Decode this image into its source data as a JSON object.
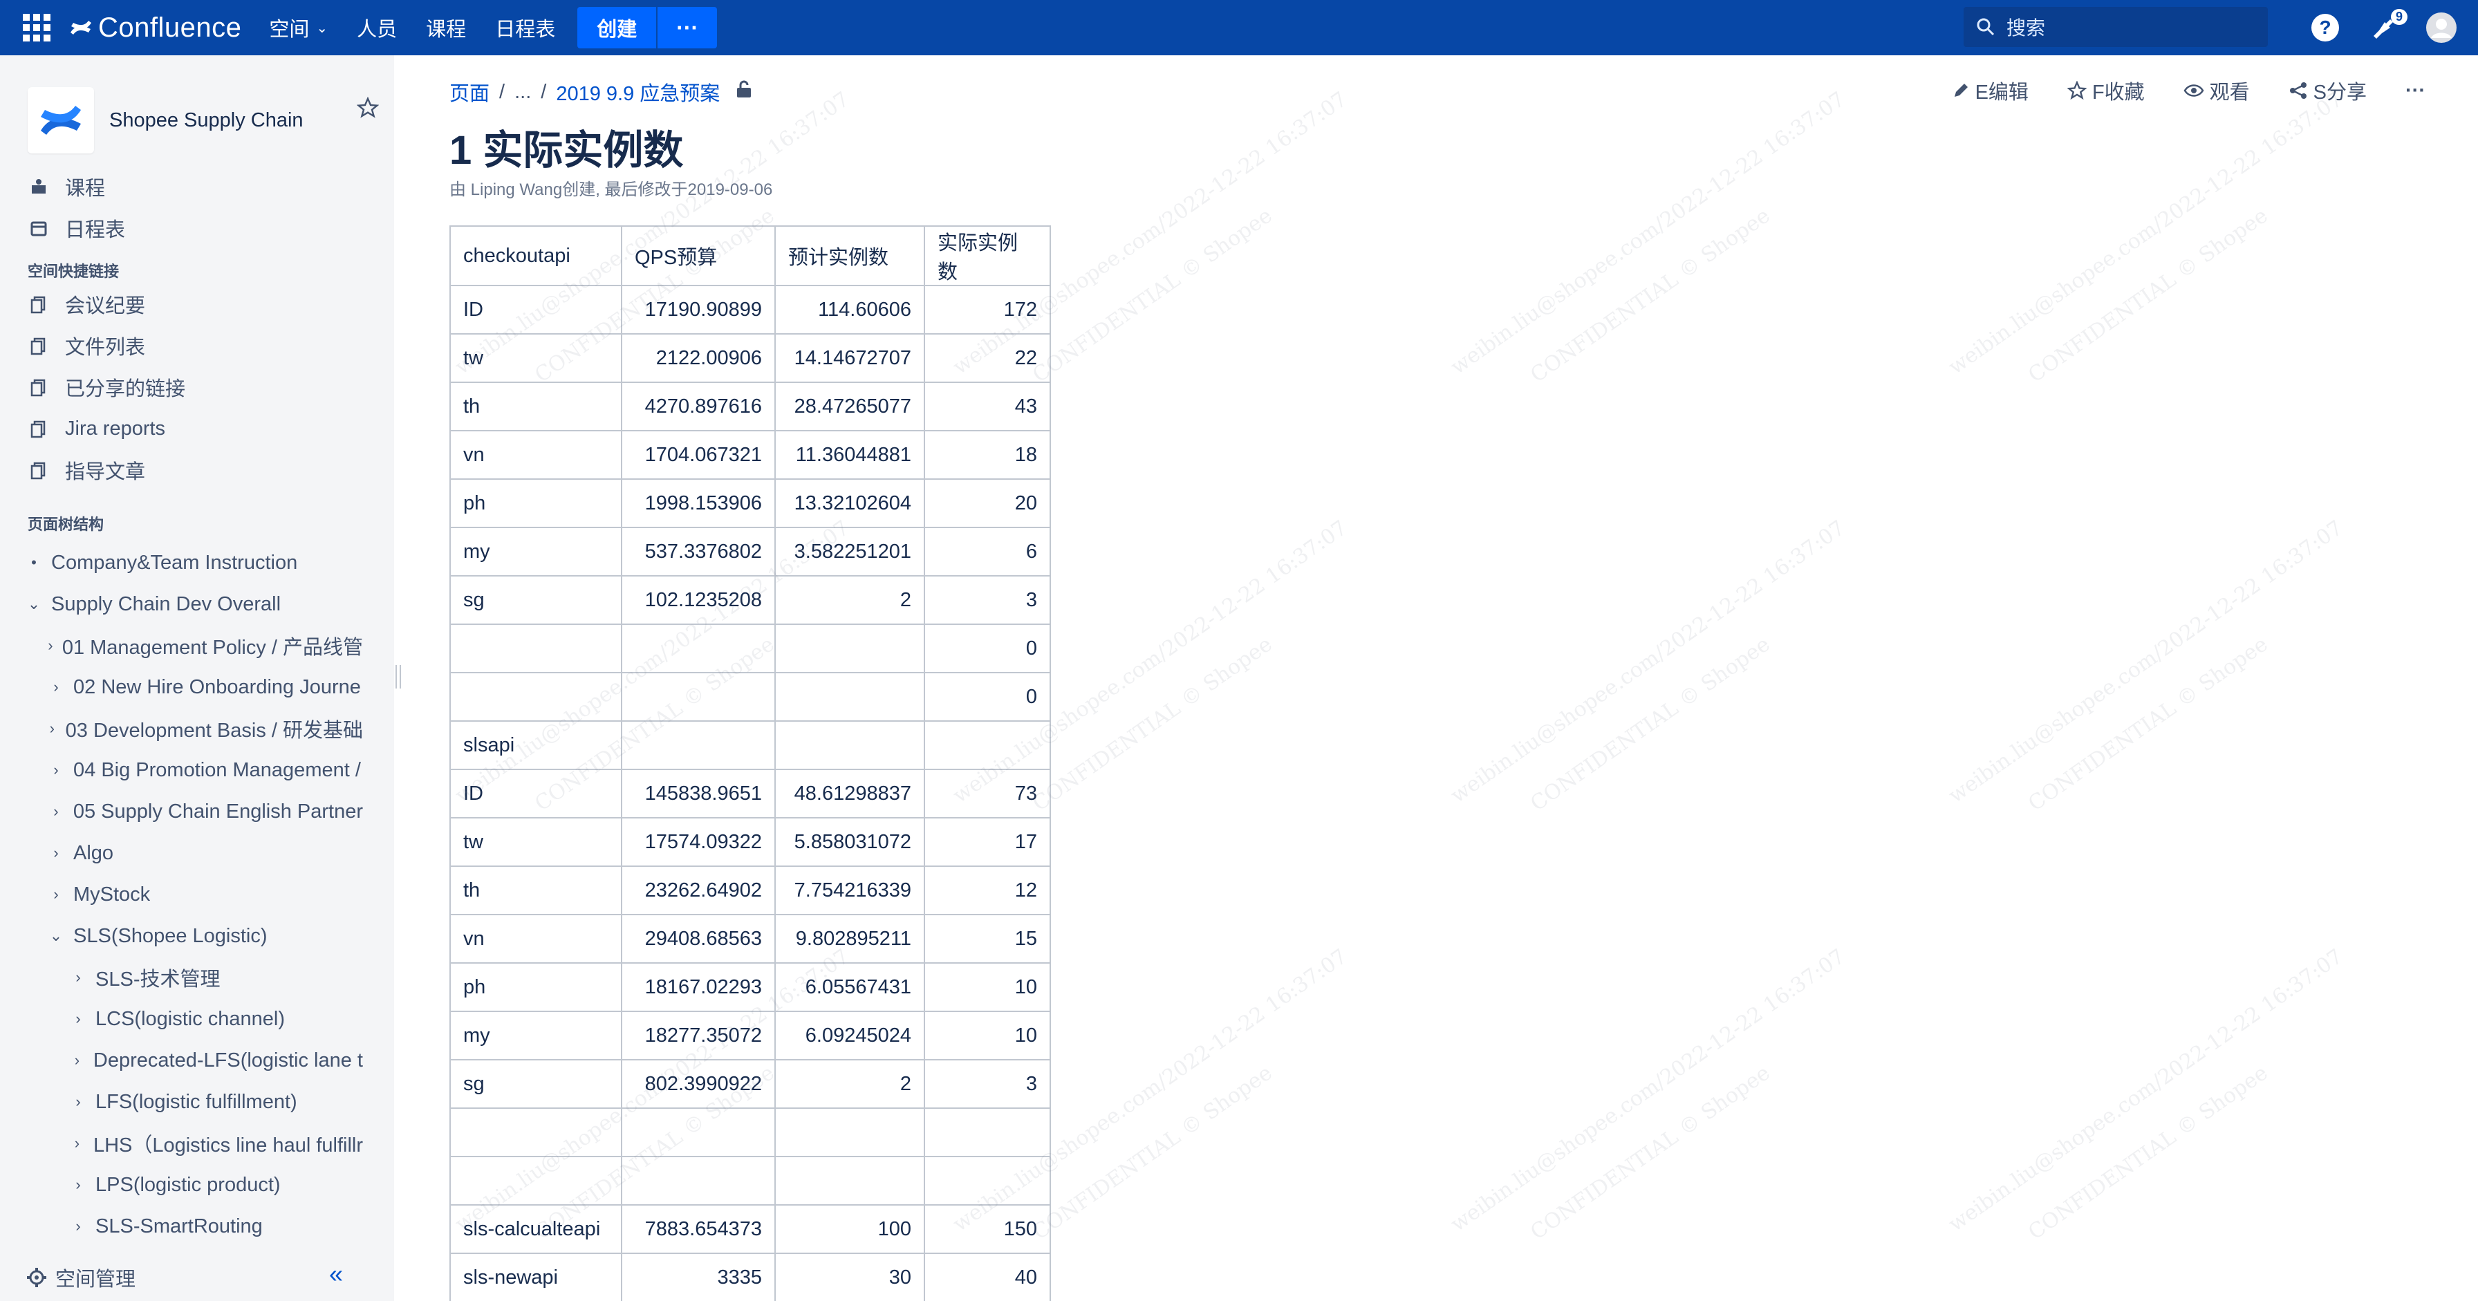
{
  "topnav": {
    "product": "Confluence",
    "items": [
      {
        "label": "空间",
        "has_dropdown": true
      },
      {
        "label": "人员"
      },
      {
        "label": "课程"
      },
      {
        "label": "日程表"
      }
    ],
    "create_label": "创建",
    "more_label": "···",
    "search_placeholder": "搜索",
    "notification_count": "9",
    "colors": {
      "bar": "#0747A6",
      "button": "#0065FF"
    }
  },
  "sidebar": {
    "space_name": "Shopee Supply Chain",
    "links": [
      {
        "label": "课程",
        "icon": "courses-icon"
      },
      {
        "label": "日程表",
        "icon": "calendar-icon"
      }
    ],
    "shortcuts_heading": "空间快捷链接",
    "shortcuts": [
      {
        "label": "会议纪要"
      },
      {
        "label": "文件列表"
      },
      {
        "label": "已分享的链接"
      },
      {
        "label": "Jira reports"
      },
      {
        "label": "指导文章"
      }
    ],
    "tree_heading": "页面树结构",
    "tree": [
      {
        "label": "Company&Team Instruction",
        "level": 0,
        "toggle": "•"
      },
      {
        "label": "Supply Chain Dev Overall",
        "level": 0,
        "toggle": "⌄"
      },
      {
        "label": "01 Management Policy / 产品线管",
        "level": 1,
        "toggle": "›"
      },
      {
        "label": "02 New Hire Onboarding Journe",
        "level": 1,
        "toggle": "›"
      },
      {
        "label": "03 Development Basis / 研发基础",
        "level": 1,
        "toggle": "›"
      },
      {
        "label": "04 Big Promotion Management /",
        "level": 1,
        "toggle": "›"
      },
      {
        "label": "05 Supply Chain English Partner",
        "level": 1,
        "toggle": "›"
      },
      {
        "label": "Algo",
        "level": 1,
        "toggle": "›"
      },
      {
        "label": "MyStock",
        "level": 1,
        "toggle": "›"
      },
      {
        "label": "SLS(Shopee Logistic)",
        "level": 1,
        "toggle": "⌄"
      },
      {
        "label": "SLS-技术管理",
        "level": 2,
        "toggle": "›"
      },
      {
        "label": "LCS(logistic channel)",
        "level": 2,
        "toggle": "›"
      },
      {
        "label": "Deprecated-LFS(logistic lane t",
        "level": 2,
        "toggle": "›"
      },
      {
        "label": "LFS(logistic fulfillment)",
        "level": 2,
        "toggle": "›"
      },
      {
        "label": "LHS（Logistics line haul fulfillr",
        "level": 2,
        "toggle": "›"
      },
      {
        "label": "LPS(logistic product)",
        "level": 2,
        "toggle": "›"
      },
      {
        "label": "SLS-SmartRouting",
        "level": 2,
        "toggle": "›"
      }
    ],
    "footer_label": "空间管理"
  },
  "breadcrumb": {
    "root": "页面",
    "ellipsis": "...",
    "parent": "2019 9.9 应急预案"
  },
  "page_actions": [
    {
      "label": "E编辑",
      "icon": "pencil-icon"
    },
    {
      "label": "F收藏",
      "icon": "star-outline-icon"
    },
    {
      "label": "观看",
      "icon": "eye-icon"
    },
    {
      "label": "S分享",
      "icon": "share-icon"
    },
    {
      "label": "···",
      "icon": "more-icon"
    }
  ],
  "page": {
    "title": "1 实际实例数",
    "byline": "由 Liping Wang创建, 最后修改于2019-09-06"
  },
  "table": {
    "rows": [
      [
        "checkoutapi",
        "QPS预算",
        "预计实例数",
        "实际实例数"
      ],
      [
        "ID",
        "17190.90899",
        "114.60606",
        "172"
      ],
      [
        "tw",
        "2122.00906",
        "14.14672707",
        "22"
      ],
      [
        "th",
        "4270.897616",
        "28.47265077",
        "43"
      ],
      [
        "vn",
        "1704.067321",
        "11.36044881",
        "18"
      ],
      [
        "ph",
        "1998.153906",
        "13.32102604",
        "20"
      ],
      [
        "my",
        "537.3376802",
        "3.582251201",
        "6"
      ],
      [
        "sg",
        "102.1235208",
        "2",
        "3"
      ],
      [
        "",
        "",
        "",
        "0"
      ],
      [
        "",
        "",
        "",
        "0"
      ],
      [
        "slsapi",
        "",
        "",
        ""
      ],
      [
        "ID",
        "145838.9651",
        "48.61298837",
        "73"
      ],
      [
        "tw",
        "17574.09322",
        "5.858031072",
        "17"
      ],
      [
        "th",
        "23262.64902",
        "7.754216339",
        "12"
      ],
      [
        "vn",
        "29408.68563",
        "9.802895211",
        "15"
      ],
      [
        "ph",
        "18167.02293",
        "6.05567431",
        "10"
      ],
      [
        "my",
        "18277.35072",
        "6.09245024",
        "10"
      ],
      [
        "sg",
        "802.3990922",
        "2",
        "3"
      ],
      [
        "",
        "",
        "",
        ""
      ],
      [
        "",
        "",
        "",
        ""
      ],
      [
        "sls-calcualteapi",
        "7883.654373",
        "100",
        "150"
      ],
      [
        "sls-newapi",
        "3335",
        "30",
        "40"
      ],
      [
        "",
        "",
        "",
        ""
      ]
    ]
  },
  "watermark": {
    "line1": "weibin.liu@shopee.com/2022-12-22 16:37:07",
    "line2": "CONFIDENTIAL © Shopee"
  }
}
